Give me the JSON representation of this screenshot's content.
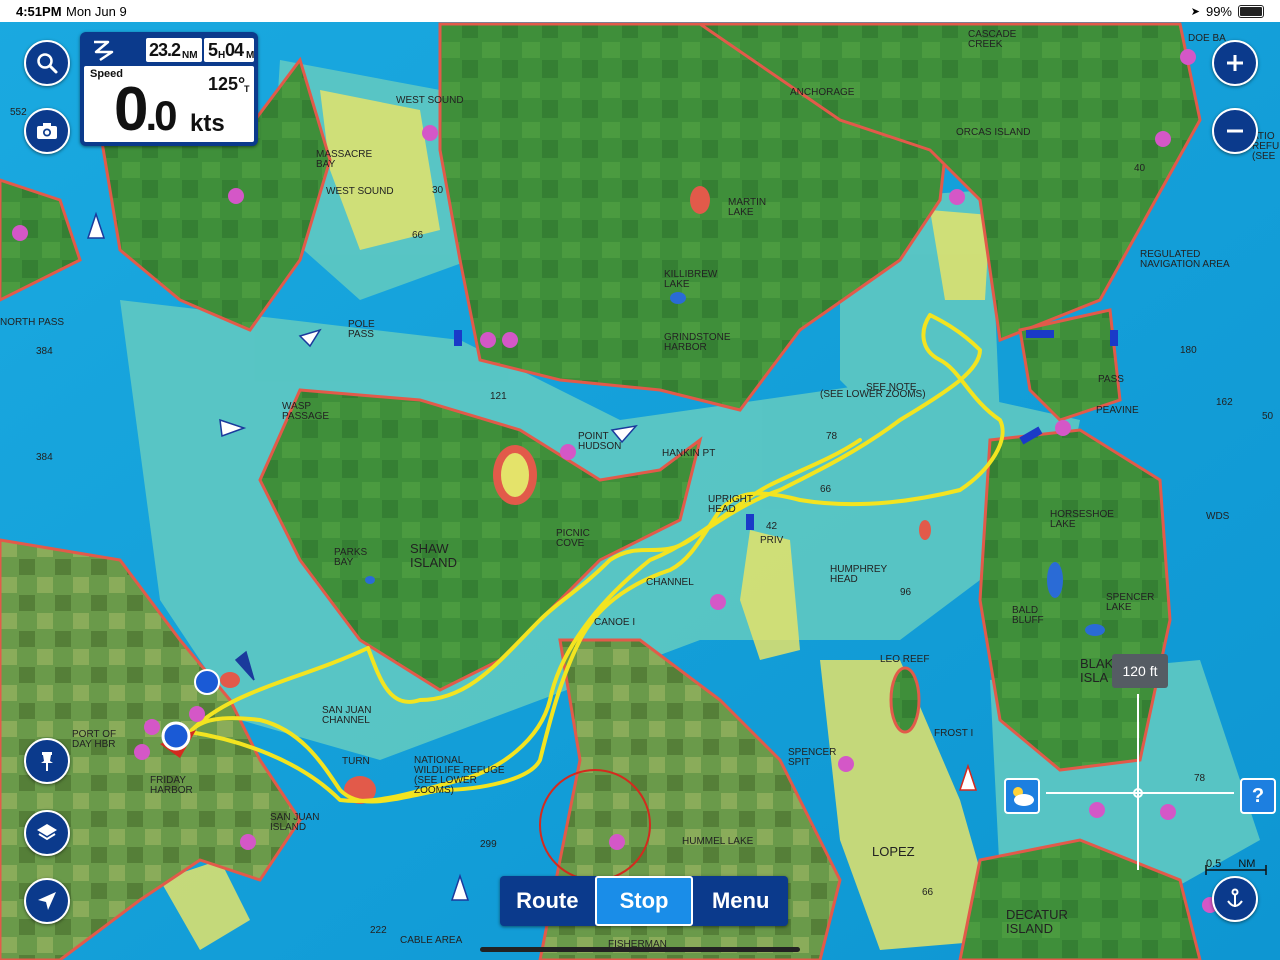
{
  "status_bar": {
    "time": "4:51PM",
    "date": "Mon Jun 9",
    "battery": "99%"
  },
  "speed_box": {
    "distance_value": "23.2",
    "distance_unit": "NM",
    "eta_hours": "5",
    "eta_h": "H",
    "eta_minutes": "04",
    "eta_m": "M",
    "speed_label": "Speed",
    "speed_whole": "0",
    "speed_decimal": ".0",
    "speed_unit": "kts",
    "heading_value": "125°",
    "heading_ref": "T"
  },
  "buttons": {
    "search": "search-icon",
    "camera": "camera-icon",
    "waypoint": "pin-icon",
    "layers": "layers-icon",
    "locate": "location-arrow-icon",
    "zoom_in": "plus-icon",
    "zoom_out": "minus-icon",
    "anchor": "anchor-person-icon",
    "weather": "weather-icon",
    "help": "?"
  },
  "bottom_bar": {
    "route": "Route",
    "stop": "Stop",
    "menu": "Menu"
  },
  "scale": {
    "crosshair_depth": "120 ft",
    "distance": "0.5",
    "unit": "NM"
  },
  "colors": {
    "deep_water": "#0fa0d6",
    "shallow": "#6fd0c8",
    "land": "#3f8f3a",
    "track": "#f3e420",
    "ui_blue": "#0b3a8c",
    "active_blue": "#1a8de8"
  },
  "map_labels": [
    {
      "id": "cascade-creek",
      "text": "CASCADE\nCREEK"
    },
    {
      "id": "anchorage",
      "text": "ANCHORAGE"
    },
    {
      "id": "orcas-island",
      "text": "ORCAS ISLAND"
    },
    {
      "id": "west-sound-1",
      "text": "WEST SOUND"
    },
    {
      "id": "massacre-bay",
      "text": "MASSACRE\nBAY"
    },
    {
      "id": "west-sound-2",
      "text": "WEST SOUND"
    },
    {
      "id": "martin-lake",
      "text": "MARTIN\nLAKE"
    },
    {
      "id": "killibrew-lake",
      "text": "KILLIBREW\nLAKE"
    },
    {
      "id": "grindstone-harbor",
      "text": "GRINDSTONE\nHARBOR"
    },
    {
      "id": "see-note",
      "text": "SEE NOTE"
    },
    {
      "id": "see-lower-zooms",
      "text": "(SEE LOWER ZOOMS)"
    },
    {
      "id": "regulated-area",
      "text": "REGULATED\nNAVIGATION AREA"
    },
    {
      "id": "north-pass",
      "text": "NORTH PASS"
    },
    {
      "id": "pole-pass",
      "text": "POLE\nPASS"
    },
    {
      "id": "wasp-passage",
      "text": "WASP\nPASSAGE"
    },
    {
      "id": "point-hudson",
      "text": "POINT\nHUDSON"
    },
    {
      "id": "hankin-pt",
      "text": "HANKIN PT"
    },
    {
      "id": "upright-head",
      "text": "UPRIGHT\nHEAD"
    },
    {
      "id": "priv",
      "text": "PRIV"
    },
    {
      "id": "pass",
      "text": "PASS"
    },
    {
      "id": "peavine",
      "text": "PEAVINE"
    },
    {
      "id": "horseshoe-lake",
      "text": "HORSESHOE\nLAKE"
    },
    {
      "id": "shaw-island",
      "text": "SHAW\nISLAND"
    },
    {
      "id": "parks-bay",
      "text": "PARKS\nBAY"
    },
    {
      "id": "picnic-cove",
      "text": "PICNIC\nCOVE"
    },
    {
      "id": "channel",
      "text": "CHANNEL"
    },
    {
      "id": "canoe-i",
      "text": "CANOE I"
    },
    {
      "id": "humphrey-head",
      "text": "HUMPHREY\nHEAD"
    },
    {
      "id": "bald-bluff",
      "text": "BALD\nBLUFF"
    },
    {
      "id": "spencer-lake",
      "text": "SPENCER\nLAKE"
    },
    {
      "id": "blakely",
      "text": "BLAK\nISLA"
    },
    {
      "id": "leo-reef",
      "text": "LEO REEF"
    },
    {
      "id": "port-of-friday",
      "text": "PORT OF\nDAY HBR"
    },
    {
      "id": "friday-harbor",
      "text": "FRIDAY\nHARBOR"
    },
    {
      "id": "san-juan-channel",
      "text": "SAN JUAN\nCHANNEL"
    },
    {
      "id": "national-wildlife",
      "text": "NATIONAL\nWILDLIFE REFUGE\n(SEE LOWER\nZOOMS)"
    },
    {
      "id": "turn",
      "text": "TURN"
    },
    {
      "id": "san-juan-island",
      "text": "SAN JUAN\nISLAND"
    },
    {
      "id": "spencer-spit",
      "text": "SPENCER\nSPIT"
    },
    {
      "id": "frost-i",
      "text": "FROST I"
    },
    {
      "id": "hummel-lake",
      "text": "HUMMEL LAKE"
    },
    {
      "id": "lopez",
      "text": "LOPEZ"
    },
    {
      "id": "decatur-island",
      "text": "DECATUR\nISLAND"
    },
    {
      "id": "cable-area",
      "text": "CABLE AREA"
    },
    {
      "id": "fisherman",
      "text": "FISHERMAN"
    },
    {
      "id": "doe-bay",
      "text": "DOE BA"
    },
    {
      "id": "wds",
      "text": "WDS"
    },
    {
      "id": "ration-refug",
      "text": "ATIO\nREFU\n(SEE"
    }
  ],
  "depth_soundings": [
    "552",
    "384",
    "384",
    "66",
    "30",
    "121",
    "78",
    "66",
    "42",
    "96",
    "40",
    "180",
    "162",
    "50",
    "78",
    "299",
    "222",
    "66"
  ]
}
